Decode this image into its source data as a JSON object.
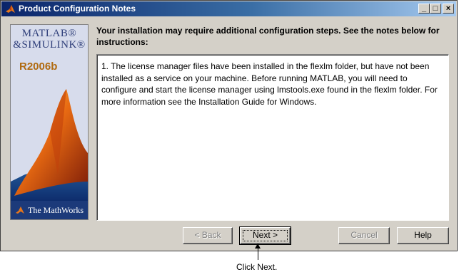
{
  "window": {
    "title": "Product Configuration Notes",
    "controls": {
      "minimize": "_",
      "maximize": "□",
      "close": "×"
    }
  },
  "splash": {
    "logo_line1": "MATLAB®",
    "logo_line2": "&SIMULINK®",
    "release": "R2006b",
    "company": "The MathWorks"
  },
  "instructions": "Your installation may require additional configuration steps.  See the notes below for instructions:",
  "notes_text": "1. The license manager files have been installed in the flexlm folder, but have not been installed as a service on your machine.  Before running MATLAB, you will need to configure and start the license manager using lmstools.exe found in the flexlm folder.  For more information see the Installation Guide for Windows.",
  "buttons": {
    "back": "< Back",
    "next": "Next >",
    "cancel": "Cancel",
    "help": "Help"
  },
  "callout": "Click Next.",
  "colors": {
    "titlebar_start": "#0a246a",
    "titlebar_end": "#a6caf0",
    "dialog_face": "#d4d0c8"
  }
}
